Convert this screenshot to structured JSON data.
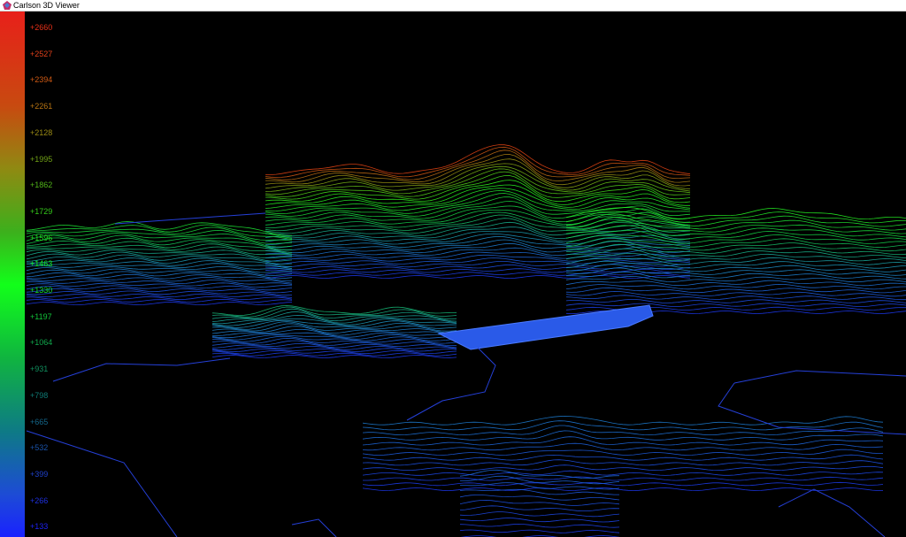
{
  "window": {
    "title": "Carlson 3D Viewer",
    "icon": "carlson-app-icon"
  },
  "legend": {
    "ticks": [
      {
        "label": "+2660",
        "color": "#e83018"
      },
      {
        "label": "+2527",
        "color": "#e0401a"
      },
      {
        "label": "+2394",
        "color": "#d05a14"
      },
      {
        "label": "+2261",
        "color": "#b87412"
      },
      {
        "label": "+2128",
        "color": "#9a8a14"
      },
      {
        "label": "+1995",
        "color": "#70a016"
      },
      {
        "label": "+1862",
        "color": "#50b418"
      },
      {
        "label": "+1729",
        "color": "#34c81a"
      },
      {
        "label": "+1596",
        "color": "#20dc1c"
      },
      {
        "label": "+1463",
        "color": "#12f01c"
      },
      {
        "label": "+1330",
        "color": "#12e02a"
      },
      {
        "label": "+1197",
        "color": "#12c43a"
      },
      {
        "label": "+1064",
        "color": "#10a84c"
      },
      {
        "label": "+931",
        "color": "#10905e"
      },
      {
        "label": "+798",
        "color": "#0f7a74"
      },
      {
        "label": "+665",
        "color": "#14668a"
      },
      {
        "label": "+532",
        "color": "#1a52a8"
      },
      {
        "label": "+399",
        "color": "#1e40c8"
      },
      {
        "label": "+266",
        "color": "#1e30e0"
      },
      {
        "label": "+133",
        "color": "#1e22f4"
      }
    ]
  }
}
